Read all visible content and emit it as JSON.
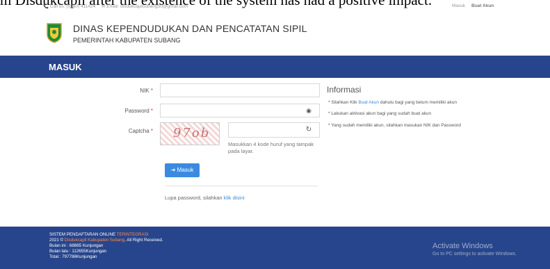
{
  "caption": "m Disdukcapil after the existence of the system has had a positive impact.",
  "topbar": {
    "call": "📞 Call us: (0260) 411424",
    "email": "✉ Email: disdukcapilsubang50@gmail.com",
    "login": "Masuk",
    "register": "Buat Akun"
  },
  "header": {
    "title": "DINAS KEPENDUDUKAN DAN PENCATATAN SIPIL",
    "subtitle": "PEMERINTAH KABUPATEN SUBANG"
  },
  "band": {
    "title": "MASUK"
  },
  "form": {
    "nik_label": "NIK",
    "password_label": "Password",
    "captcha_label": "Captcha",
    "required_mark": "*",
    "captcha_text": "97ob",
    "captcha_help": "Masukkan 4 kode huruf yang tampak pada layar.",
    "submit_label": "➜ Masuk",
    "forgot_text": "Lupa password, silahkan",
    "forgot_link": "klik disini"
  },
  "info": {
    "title": "Informasi",
    "item1_prefix": "* Silahkan Klik",
    "item1_link": "Buat Akun",
    "item1_suffix": "dahulu bagi yang belum memiliki akun",
    "item2": "* Lakukan aktivasi akun bagi yang sudah buat akun",
    "item3": "* Yang sudah memiliki akun, silahkan masukan NIK dan Password"
  },
  "footer": {
    "line1_prefix": "SISTEM PENDAFTARAN ONLINE",
    "line1_highlight": "TERINTEGRASI",
    "line2_prefix": "2021 ©",
    "line2_highlight": "Disdukcapil Kabupaten Subang",
    "line2_suffix": ". All Right Received.",
    "line3": "Bulan ini :  68865  Kunjungan",
    "line4": "Bulan lalu : 112655Kunjungan",
    "line5": "Total :      797786Kunjungan"
  },
  "watermark": {
    "title": "Activate Windows",
    "subtitle": "Go to PC settings to activate Windows."
  },
  "colors": {
    "band": "#27458c",
    "accent": "#3a8be0",
    "required": "#e53935",
    "highlight": "#ff8c42"
  }
}
